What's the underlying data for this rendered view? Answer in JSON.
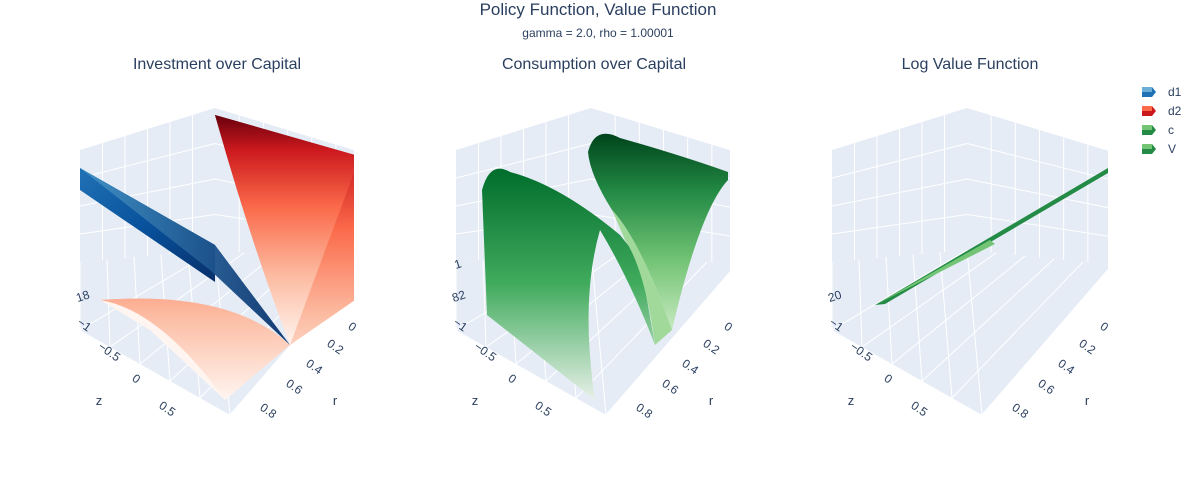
{
  "figure": {
    "title": "Policy Function, Value Function",
    "subtitle": "gamma = 2.0, rho = 1.00001"
  },
  "panels": [
    {
      "title": "Investment over Capital",
      "z_tick_partial": "18",
      "z_tick_high": ""
    },
    {
      "title": "Consumption over Capital",
      "z_tick_partial": "82",
      "z_tick_high": "1"
    },
    {
      "title": "Log Value Function",
      "z_tick_partial": "20",
      "z_tick_high": ""
    }
  ],
  "axes": {
    "x_label": "z",
    "y_label": "r",
    "x_ticks": [
      "−1",
      "−0.5",
      "0",
      "0.5"
    ],
    "y_ticks": [
      "0",
      "0.2",
      "0.4",
      "0.6",
      "0.8"
    ]
  },
  "legend": [
    {
      "name": "d1",
      "color_dark": "#08306b",
      "color_light": "#6baed6"
    },
    {
      "name": "d2",
      "color_dark": "#67000d",
      "color_light": "#fb6a4a"
    },
    {
      "name": "c",
      "color_dark": "#00441b",
      "color_light": "#74c476"
    },
    {
      "name": "V",
      "color_dark": "#00441b",
      "color_light": "#74c476"
    }
  ],
  "colors": {
    "scene_bg": "#e5ecf6",
    "grid": "#ffffff",
    "text": "#2a3f5f",
    "blues": [
      "#f7fbff",
      "#c6dbef",
      "#6baed6",
      "#2171b5",
      "#08306b"
    ],
    "reds": [
      "#fff5f0",
      "#fcbba1",
      "#fb6a4a",
      "#cb181d",
      "#67000d"
    ],
    "greens": [
      "#f7fcf5",
      "#c7e9c0",
      "#74c476",
      "#238b45",
      "#00441b"
    ]
  },
  "chart_data": [
    {
      "type": "surface",
      "title": "Investment over Capital",
      "xlabel": "z",
      "ylabel": "r",
      "zlabel": "",
      "xlim": [
        -1,
        1
      ],
      "ylim": [
        0,
        1
      ],
      "series": [
        {
          "name": "d1",
          "colorscale": "Blues",
          "shape": "plane falling toward high z"
        },
        {
          "name": "d2",
          "colorscale": "Reds",
          "shape": "u-shaped parabola in z, constant in r"
        }
      ]
    },
    {
      "type": "surface",
      "title": "Consumption over Capital",
      "xlabel": "z",
      "ylabel": "r",
      "zlabel": "",
      "xlim": [
        -1,
        1
      ],
      "ylim": [
        0,
        1
      ],
      "series": [
        {
          "name": "c",
          "colorscale": "Greens",
          "shape": "two ridges (sinusoidal in z), constant in r"
        }
      ]
    },
    {
      "type": "surface",
      "title": "Log Value Function",
      "xlabel": "z",
      "ylabel": "r",
      "zlabel": "",
      "xlim": [
        -1,
        1
      ],
      "ylim": [
        0,
        1
      ],
      "series": [
        {
          "name": "V",
          "colorscale": "Greens",
          "shape": "thin near-linear sheet"
        }
      ]
    }
  ]
}
